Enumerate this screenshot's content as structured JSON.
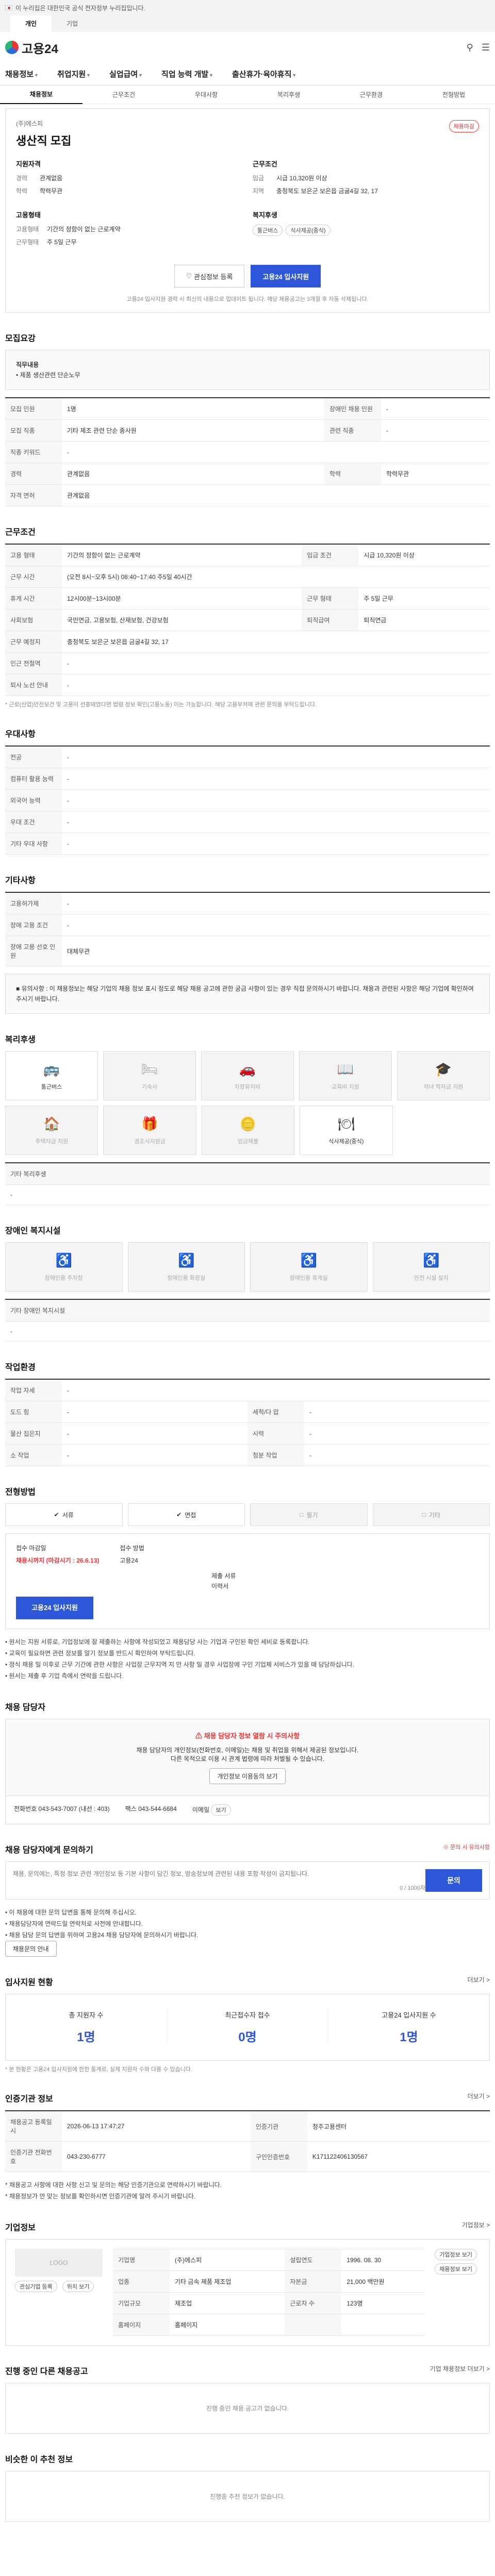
{
  "gov_banner": "이 누리집은 대한민국 공식 전자정부 누리집입니다.",
  "top_tabs": [
    "개인",
    "기업"
  ],
  "logo": "고용24",
  "gnb": [
    "채용정보",
    "취업지원",
    "실업급여",
    "직업 능력 개발",
    "출산휴가·육아휴직"
  ],
  "sub_tabs": [
    "채용정보",
    "근무조건",
    "우대사항",
    "복리후생",
    "근무환경",
    "전형방법"
  ],
  "job": {
    "org": "(주)에스피",
    "title": "생산직 모집",
    "badge": "채용마감",
    "left_title": "지원자격",
    "left": [
      {
        "k": "경력",
        "v": "관계없음"
      },
      {
        "k": "학력",
        "v": "학력무관"
      }
    ],
    "right_title": "근무조건",
    "right": [
      {
        "k": "임금",
        "v": "시급 10,320원 이상"
      },
      {
        "k": "지역",
        "v": "충청북도 보은군 보은읍 금굴4길 32, 17"
      }
    ],
    "left2_title": "고용형태",
    "left2": [
      {
        "k": "고용형태",
        "v": "기간의 정함이 없는 근로계약"
      },
      {
        "k": "근무형태",
        "v": "주 5일 근무"
      }
    ],
    "right2_title": "복지후생",
    "right2_chips": [
      "통근버스",
      "식사제공(중식)"
    ],
    "btn_scrap": "관심정보 등록",
    "btn_apply": "고용24 입사지원",
    "note": "고용24 입사지원 경력 시 최신의 내용으로 업데이트 됩니다. 해당 채용공고는 3개월 후 자동 삭제됩니다."
  },
  "recruit": {
    "title": "모집요강",
    "box_title": "직무내용",
    "box_text": "• 제품 생산관련 단순노무",
    "rows": [
      [
        "모집 인원",
        "1명",
        "장애인 채용 인원",
        "-"
      ],
      [
        "모집 직종",
        "기타 제조 관련 단순 종사원",
        "관련 직종",
        "-"
      ],
      [
        "직종 키워드",
        "-",
        "",
        ""
      ],
      [
        "경력",
        "관계없음",
        "학력",
        "학력무관"
      ],
      [
        "자격 면허",
        "관계없음",
        "",
        ""
      ]
    ]
  },
  "work": {
    "title": "근무조건",
    "rows": [
      [
        "고용 형태",
        "기간의 정함이 없는 근로계약",
        "임금 조건",
        "시급 10,320원 이상"
      ],
      [
        "근무 시간",
        "(오전 8시~오후 5시) 08:40~17:40 주5일 40시간",
        "",
        ""
      ],
      [
        "휴게 시간",
        "12시00분~13시00분",
        "근무 형태",
        "주 5일 근무"
      ],
      [
        "사회보험",
        "국민연금, 고용보험, 산재보험, 건강보험",
        "퇴직급여",
        "퇴직연금"
      ],
      [
        "근무 예정지",
        "충청북도 보은군 보은읍 금굴4길 32, 17",
        "",
        ""
      ],
      [
        "인근 전철역",
        "-",
        "",
        ""
      ],
      [
        "퇴사 노선 안내",
        "-",
        "",
        ""
      ]
    ],
    "note": "* 근로(산업)안전보건 및 고용이 선충돼었다면 법령 정보 확인(고용노동) 이는 가능합니다. 해당 고용부처에 관련 문의를 부탁드립니다."
  },
  "pref": {
    "title": "우대사항",
    "rows": [
      [
        "전공",
        "-"
      ],
      [
        "컴퓨터 활용 능력",
        "-"
      ],
      [
        "외국어 능력",
        "-"
      ],
      [
        "우대 조건",
        "-"
      ],
      [
        "기타 우대 사항",
        "-"
      ]
    ]
  },
  "etc": {
    "title": "기타사항",
    "rows": [
      [
        "고용허가제",
        "-"
      ],
      [
        "장애 고용 조건",
        "-"
      ],
      [
        "장애 고용 선호 인원",
        "대체무관"
      ]
    ],
    "box": "■ 유의사항 : 이 채용정보는 해당 기업의 채용 정보 표시 정도로 해당 채용 공고에 관한 궁금 사항이 있는 경우 직접 문의하시기 바랍니다. 채용과 관련된 사항은 해당 기업에 확인하여 주시기 바랍니다."
  },
  "welfare": {
    "title": "복리후생",
    "items": [
      {
        "label": "통근버스",
        "on": true,
        "icon": "bus-icon"
      },
      {
        "label": "기숙사",
        "on": false,
        "icon": "bed-icon"
      },
      {
        "label": "차량유지비",
        "on": false,
        "icon": "car-icon"
      },
      {
        "label": "교육비 지원",
        "on": false,
        "icon": "book-icon"
      },
      {
        "label": "자녀 학자금 지원",
        "on": false,
        "icon": "grad-icon"
      },
      {
        "label": "주택자금 지원",
        "on": false,
        "icon": "house-icon"
      },
      {
        "label": "경조사지원금",
        "on": false,
        "icon": "gift-icon"
      },
      {
        "label": "임금체불",
        "on": false,
        "icon": "coin-icon"
      },
      {
        "label": "식사제공(중식)",
        "on": true,
        "icon": "meal-icon"
      }
    ],
    "extra_label": "기타 복리후생",
    "extra_val": "-"
  },
  "disab": {
    "title": "장애인 복지시설",
    "items": [
      "장애인용 주차장",
      "장애인용 화장실",
      "장애인용 휴게실",
      "안전 시설 설치"
    ],
    "extra_label": "기타 장애인 복지시설",
    "extra_val": "-"
  },
  "env": {
    "title": "작업환경",
    "rows": [
      [
        "작업 자세",
        "-",
        "",
        ""
      ],
      [
        "도드 힘",
        "-",
        "세척/다 압",
        "-"
      ],
      [
        "물산 집은지",
        "-",
        "시력",
        "-"
      ],
      [
        "소 작업",
        "-",
        "청분 작업",
        "-"
      ]
    ]
  },
  "method": {
    "title": "전형방법",
    "items": [
      {
        "label": "서류",
        "on": true
      },
      {
        "label": "면접",
        "on": true
      },
      {
        "label": "필기",
        "on": false
      },
      {
        "label": "기타",
        "on": false
      }
    ],
    "deadline_label": "접수 마감일",
    "deadline": "채용시까지 (마감시기 : 26.6.13)",
    "way_label": "접수 방법",
    "way": "고용24",
    "docs_label": "제출 서류",
    "docs": "이력서",
    "apply_btn": "고용24 입사지원",
    "notes": [
      "• 원서는 지원 서류로, 기업정보에 잘 제출하는 사항에 작성되었고 채용담당 사는 기업과 구인된 확인 세비로 등록합니다.",
      "• 교육이 필요하면 관련 정보를 알기 정보를 반드시 확인하여 부탁드립니다.",
      "• 정식 채용 일 이후로 근무 기간에 관한 사항은 사업장 근무지역 지 안 사항 일 경우 사업장에 구인 기업체 서비스가 있을 때 담당하십니다.",
      "• 원서는 제출 후 기업 측에서 연락을 드립니다."
    ]
  },
  "manager": {
    "title": "채용 담당자",
    "alert": "채용 담당자 정보 열람 시 주의사항",
    "msg1": "채용 담당자의 개인정보(전화번호, 이메일)는 채용 및 취업을 위해서 제공된 정보입니다.",
    "msg2": "다른 목적으로 이용 시 관계 법령에 따라 처벌될 수 있습니다.",
    "view_btn": "개인정보 이용동의 보기",
    "phone_label": "전화번호",
    "phone": "043-543-7007 (내선 : 403)",
    "fax_label": "팩스",
    "fax": "043-544-6684",
    "email_label": "이메일",
    "email_btn": "보기"
  },
  "qna": {
    "title": "채용 담당자에게 문의하기",
    "hint": "※ 문의 시 유의사항",
    "placeholder": "채용, 문의에는, 특정 정보 관련 개인정보 등 기본 사항이 담긴 정보, 방송정보에 관련된 내용 포함 작성이 금지됩니다.",
    "count": "0 / 1000자",
    "submit": "문의",
    "notes": [
      "• 이 채용에 대한 문의 답변을 통해 문의해 주십시오.",
      "• 채용담당자에 연락드릴 연락처로 사전에 안내합니다.",
      "• 채용 담당 문의 답변을 위하여 고용24 채용 담당자에 문의하시기 바랍니다."
    ],
    "notice_btn": "채용문의 안내"
  },
  "stats": {
    "title": "입사지원 현황",
    "more": "더보기 >",
    "items": [
      {
        "label": "총 지원자 수",
        "val": "1명"
      },
      {
        "label": "최근접수자 접수",
        "val": "0명"
      },
      {
        "label": "고용24 입사지원 수",
        "val": "1명"
      }
    ],
    "note": "* 본 현황은 고용24 입사지원에 한한 통계로, 실제 지원자 수와 다를 수 있습니다."
  },
  "info": {
    "title": "인증기관 정보",
    "more": "더보기 >",
    "rows": [
      [
        "채용공고 등록일시",
        "2026-06-13 17:47:27",
        "인증기관",
        "청주고용센터"
      ],
      [
        "인증기관 전화번호",
        "043-230-6777",
        "구인인증번호",
        "K171122406130567"
      ]
    ],
    "btn": "주관 보기",
    "notes": [
      "* 채용공고 사항에 대한 사항 신고 및 문의는 해당 인증기관으로 연락하시기 바랍니다.",
      "* 채용정보가 안 맞는 정보를 확인하시면 인증기관에 알려 주시기 바랍니다."
    ]
  },
  "company": {
    "title": "기업정보",
    "more": "기업정보 >",
    "logo_text": "LOGO",
    "btn1": "관심기업 등록",
    "btn2": "위치 보기",
    "rows": [
      [
        "기업명",
        "(주)에스피",
        "설립연도",
        "1996. 08. 30"
      ],
      [
        "업종",
        "기타 금속 제품 제조업",
        "자본금",
        "21,000 백만원"
      ],
      [
        "기업규모",
        "제조업",
        "근로자 수",
        "123명"
      ],
      [
        "홈페이지",
        "홈페이지",
        "",
        " "
      ]
    ],
    "btn3": "기업정보 보기",
    "btn4": "채용정보 보기"
  },
  "other": {
    "title": "진행 중인 다른 채용공고",
    "more": "기업 채용정보 더보기 >",
    "empty": "진행 중인 채용 공고가 없습니다."
  },
  "similar": {
    "title": "비슷한 이 추천 정보",
    "empty": "진행중 추천 정보가 없습니다."
  }
}
